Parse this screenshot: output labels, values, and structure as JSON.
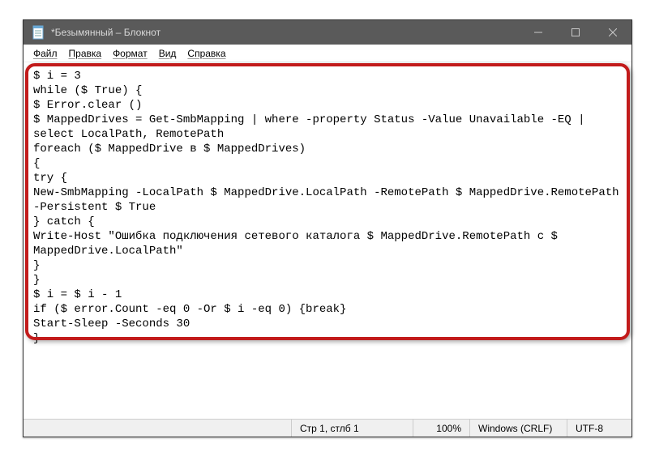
{
  "title": "*Безымянный – Блокнот",
  "menu": {
    "file": "Файл",
    "edit": "Правка",
    "format": "Формат",
    "view": "Вид",
    "help": "Справка"
  },
  "editor": {
    "text": "$ i = 3\nwhile ($ True) {\n$ Error.clear ()\n$ MappedDrives = Get-SmbMapping | where -property Status -Value Unavailable -EQ | select LocalPath, RemotePath\nforeach ($ MappedDrive в $ MappedDrives)\n{\ntry {\nNew-SmbMapping -LocalPath $ MappedDrive.LocalPath -RemotePath $ MappedDrive.RemotePath -Persistent $ True\n} catch {\nWrite-Host \"Ошибка подключения сетевого каталога $ MappedDrive.RemotePath с $ MappedDrive.LocalPath\"\n}\n}\n$ i = $ i - 1\nif ($ error.Count -eq 0 -Or $ i -eq 0) {break}\nStart-Sleep -Seconds 30\n}"
  },
  "status": {
    "position": "Стр 1, стлб 1",
    "zoom": "100%",
    "line_ending": "Windows (CRLF)",
    "encoding": "UTF-8"
  }
}
